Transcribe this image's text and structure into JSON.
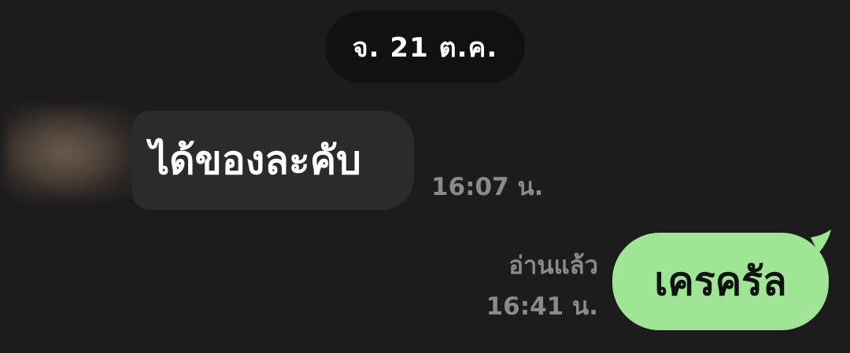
{
  "date_separator": "จ. 21 ต.ค.",
  "messages": [
    {
      "direction": "incoming",
      "text": "ได้ของละคับ",
      "time": "16:07 น."
    },
    {
      "direction": "outgoing",
      "text": "เครครัล",
      "read_status": "อ่านแล้ว",
      "time": "16:41 น."
    }
  ],
  "colors": {
    "background": "#1c1c1c",
    "incoming_bubble": "#2b2b2b",
    "outgoing_bubble": "#a0e595",
    "meta_text": "#8a8a8a"
  }
}
